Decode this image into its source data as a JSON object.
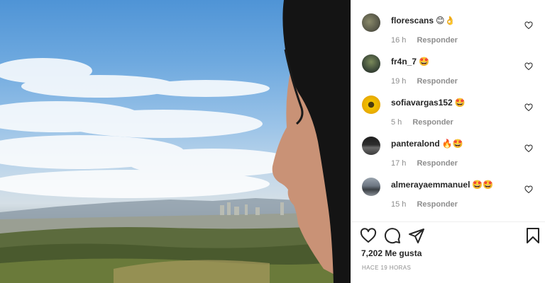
{
  "post": {
    "image_alt_scene": "sky-city-profile",
    "likes": "7,202 Me gusta",
    "posted": "HACE 19 HORAS"
  },
  "comments": [
    {
      "user": "florescans",
      "emoji": "😊👌",
      "time": "16 h",
      "reply": "Responder",
      "avatar_color": "#5a5a4a"
    },
    {
      "user": "fr4n_7",
      "emoji": "🤩",
      "time": "19 h",
      "reply": "Responder",
      "avatar_color": "#3d4a3a"
    },
    {
      "user": "sofiavargas152",
      "emoji": "🤩",
      "time": "5 h",
      "reply": "Responder",
      "avatar_color": "#e7b400"
    },
    {
      "user": "panteralond",
      "emoji": "🔥🤩",
      "time": "17 h",
      "reply": "Responder",
      "avatar_color": "#2e2e2e"
    },
    {
      "user": "almerayaemmanuel",
      "emoji": "🤩🤩",
      "time": "15 h",
      "reply": "Responder",
      "avatar_color": "#6d7682"
    }
  ],
  "icons": {
    "like": "heart-icon",
    "comment": "comment-icon",
    "share": "share-icon",
    "save": "bookmark-icon",
    "comment_like": "heart-small-icon"
  },
  "colors": {
    "text": "#262626",
    "muted": "#8e8e8e",
    "border": "#efefef"
  }
}
